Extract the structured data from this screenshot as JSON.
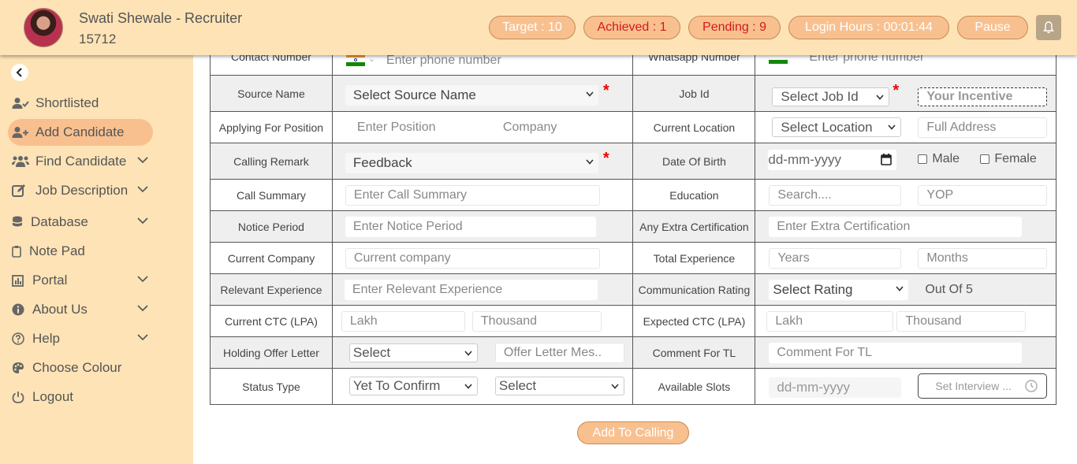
{
  "header": {
    "user_name": "Swati Shewale - Recruiter",
    "user_id": "15712",
    "target": "Target : 10",
    "achieved": "Achieved : 1",
    "pending": "Pending : 9",
    "login_hours": "Login Hours : 00:01:44",
    "pause": "Pause"
  },
  "sidebar": {
    "items": [
      {
        "label": "Shortlisted",
        "icon": "user-check-icon"
      },
      {
        "label": "Add Candidate",
        "icon": "user-plus-icon"
      },
      {
        "label": "Find Candidate",
        "icon": "users-icon"
      },
      {
        "label": "Job Description",
        "icon": "edit-icon"
      },
      {
        "label": "Database",
        "icon": "database-icon"
      },
      {
        "label": "Note Pad",
        "icon": "clipboard-icon"
      },
      {
        "label": "Portal",
        "icon": "chart-icon"
      },
      {
        "label": "About Us",
        "icon": "info-icon"
      },
      {
        "label": "Help",
        "icon": "question-icon"
      },
      {
        "label": "Choose Colour",
        "icon": "palette-icon"
      },
      {
        "label": "Logout",
        "icon": "power-icon"
      }
    ]
  },
  "form": {
    "contact_number_label": "Contact Number",
    "contact_placeholder": "Enter phone number",
    "whatsapp_label": "Whatsapp Number",
    "whatsapp_placeholder": "Enter phone number",
    "source_name_label": "Source Name",
    "source_name_value": "Select Source Name",
    "job_id_label": "Job Id",
    "job_id_value": "Select Job Id",
    "incentive_placeholder": "Your Incentive",
    "applying_label": "Applying For Position",
    "position_placeholder": "Enter Position",
    "company_placeholder": "Company",
    "current_location_label": "Current Location",
    "location_value": "Select Location",
    "address_placeholder": "Full Address",
    "calling_remark_label": "Calling Remark",
    "calling_remark_value": "Feedback",
    "dob_label": "Date Of Birth",
    "dob_placeholder": "dd-mm-yyyy",
    "male_label": "Male",
    "female_label": "Female",
    "call_summary_label": "Call Summary",
    "call_summary_placeholder": "Enter Call Summary",
    "education_label": "Education",
    "education_placeholder": "Search....",
    "yop_placeholder": "YOP",
    "notice_label": "Notice Period",
    "notice_placeholder": "Enter Notice Period",
    "extra_cert_label": "Any Extra Certification",
    "extra_cert_placeholder": "Enter Extra Certification",
    "current_company_label": "Current Company",
    "current_company_placeholder": "Current company",
    "total_exp_label": "Total Experience",
    "years_placeholder": "Years",
    "months_placeholder": "Months",
    "relevant_exp_label": "Relevant Experience",
    "relevant_exp_placeholder": "Enter Relevant Experience",
    "comm_rating_label": "Communication Rating",
    "rating_value": "Select Rating",
    "out_of": "Out Of 5",
    "current_ctc_label": "Current CTC (LPA)",
    "lakh_placeholder": "Lakh",
    "thousand_placeholder": "Thousand",
    "expected_ctc_label": "Expected CTC (LPA)",
    "exp_lakh_placeholder": "Lakh",
    "exp_thousand_placeholder": "Thousand",
    "holding_offer_label": "Holding Offer Letter",
    "holding_value": "Select",
    "offer_msg_placeholder": "Offer Letter Mes..",
    "comment_tl_label": "Comment For TL",
    "comment_tl_placeholder": "Comment For TL",
    "status_type_label": "Status Type",
    "status_value": "Yet To Confirm",
    "status_second_value": "Select",
    "available_slots_label": "Available Slots",
    "slot_date_placeholder": "dd-mm-yyyy",
    "set_interview": "Set Interview ..."
  },
  "submit_label": "Add To Calling",
  "colors": {
    "header_bg": "#fde3b6",
    "accent": "#f9c08f",
    "required": "#e00000",
    "achieved_text": "#d21a1a"
  }
}
